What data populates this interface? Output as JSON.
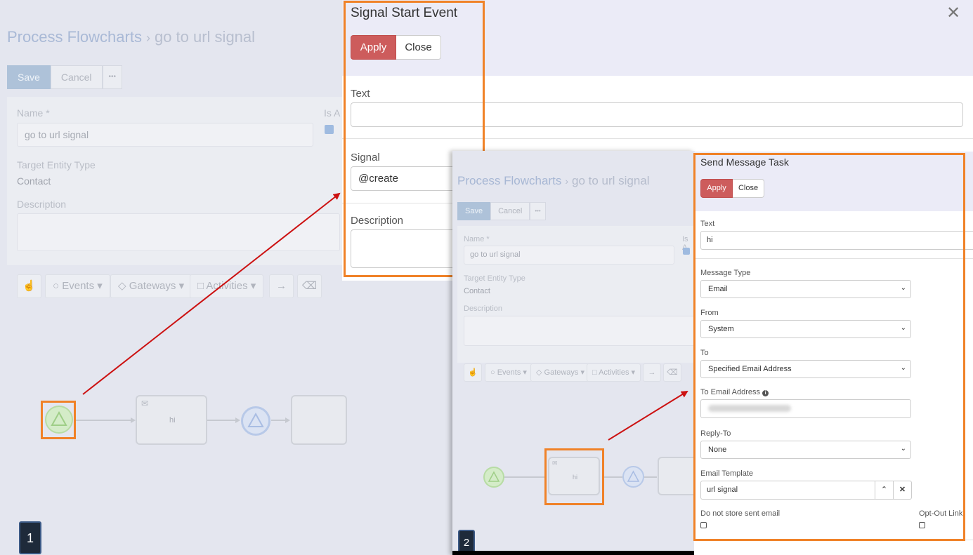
{
  "screen1": {
    "breadcrumb_link": "Process Flowcharts",
    "breadcrumb_sep": "›",
    "breadcrumb_current": "go to url signal",
    "save": "Save",
    "cancel": "Cancel",
    "more": "•••",
    "name_label": "Name *",
    "name_value": "go to url signal",
    "is_active_label": "Is A",
    "target_label": "Target Entity Type",
    "target_value": "Contact",
    "description_label": "Description",
    "toolbar": {
      "events": "Events",
      "gateways": "Gateways",
      "activities": "Activities"
    },
    "task_text": "hi",
    "step": "1"
  },
  "modal1": {
    "title": "Signal Start Event",
    "apply": "Apply",
    "close": "Close",
    "text_label": "Text",
    "text_value": "",
    "signal_label": "Signal",
    "signal_value": "@create",
    "description_label": "Description"
  },
  "screen2": {
    "breadcrumb_link": "Process Flowcharts",
    "breadcrumb_sep": "›",
    "breadcrumb_current": "go to url signal",
    "save": "Save",
    "cancel": "Cancel",
    "more": "•••",
    "name_label": "Name *",
    "name_value": "go to url signal",
    "is_active_label": "Is A",
    "target_label": "Target Entity Type",
    "target_value": "Contact",
    "description_label": "Description",
    "toolbar": {
      "events": "Events",
      "gateways": "Gateways",
      "activities": "Activities"
    },
    "task_text": "hi",
    "step": "2"
  },
  "modal2": {
    "title": "Send Message Task",
    "apply": "Apply",
    "close": "Close",
    "text_label": "Text",
    "text_value": "hi",
    "message_type_label": "Message Type",
    "message_type_value": "Email",
    "from_label": "From",
    "from_value": "System",
    "to_label": "To",
    "to_value": "Specified Email Address",
    "to_email_label": "To Email Address",
    "reply_to_label": "Reply-To",
    "reply_to_value": "None",
    "email_template_label": "Email Template",
    "email_template_value": "url signal",
    "do_not_store_label": "Do not store sent email",
    "opt_out_label": "Opt-Out Link"
  },
  "colors": {
    "accent_orange": "#f08228",
    "apply_red": "#cd5c5c",
    "arrow_red": "#cc1111",
    "header_lavender": "#ebebf7"
  }
}
